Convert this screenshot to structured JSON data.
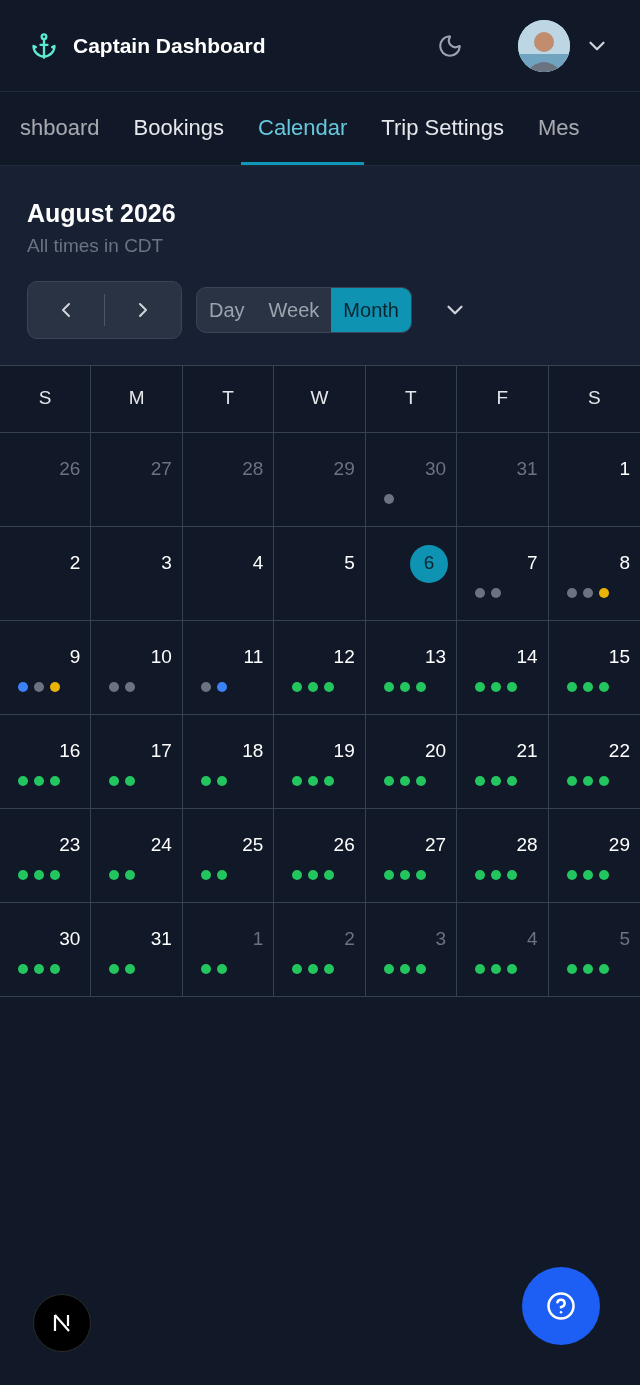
{
  "app_title": "Captain Dashboard",
  "tabs": [
    {
      "label": "shboard",
      "selected": false
    },
    {
      "label": "Bookings",
      "selected": false
    },
    {
      "label": "Calendar",
      "selected": true
    },
    {
      "label": "Trip Settings",
      "selected": false
    },
    {
      "label": "Mes",
      "selected": false
    }
  ],
  "calendar": {
    "month_title": "August 2026",
    "timezone_note": "All times in CDT",
    "views": [
      {
        "label": "Day",
        "selected": false
      },
      {
        "label": "Week",
        "selected": false
      },
      {
        "label": "Month",
        "selected": true
      }
    ],
    "weekdays": [
      "S",
      "M",
      "T",
      "W",
      "T",
      "F",
      "S"
    ],
    "weeks": [
      {
        "days": [
          {
            "date": "26",
            "muted": true,
            "today": false
          },
          {
            "date": "27",
            "muted": true,
            "today": false
          },
          {
            "date": "28",
            "muted": true,
            "today": false
          },
          {
            "date": "29",
            "muted": true,
            "today": false
          },
          {
            "date": "30",
            "muted": true,
            "today": false,
            "dots": [
              {
                "color": "#6b7280"
              }
            ]
          },
          {
            "date": "31",
            "muted": true,
            "today": false
          },
          {
            "date": "1",
            "muted": false,
            "today": false
          }
        ]
      },
      {
        "days": [
          {
            "date": "2",
            "muted": false,
            "today": false
          },
          {
            "date": "3",
            "muted": false,
            "today": false
          },
          {
            "date": "4",
            "muted": false,
            "today": false
          },
          {
            "date": "5",
            "muted": false,
            "today": false
          },
          {
            "date": "6",
            "today": true
          },
          {
            "date": "7",
            "muted": false,
            "today": false,
            "dots": [
              {
                "color": "#6b7280"
              },
              {
                "color": "#6b7280"
              }
            ]
          },
          {
            "date": "8",
            "muted": false,
            "today": false,
            "dots": [
              {
                "color": "#6b7280"
              },
              {
                "color": "#6b7280"
              },
              {
                "color": "#eab308"
              }
            ]
          }
        ]
      },
      {
        "days": [
          {
            "date": "9",
            "muted": false,
            "today": false,
            "dots": [
              {
                "color": "#3b82f6"
              },
              {
                "color": "#6b7280"
              },
              {
                "color": "#eab308"
              }
            ]
          },
          {
            "date": "10",
            "muted": false,
            "today": false,
            "dots": [
              {
                "color": "#6b7280"
              },
              {
                "color": "#6b7280"
              }
            ]
          },
          {
            "date": "11",
            "muted": false,
            "today": false,
            "dots": [
              {
                "color": "#6b7280"
              },
              {
                "color": "#3b82f6"
              }
            ]
          },
          {
            "date": "12",
            "muted": false,
            "today": false,
            "dots": [
              {
                "color": "#22c55e"
              },
              {
                "color": "#22c55e"
              },
              {
                "color": "#22c55e"
              }
            ]
          },
          {
            "date": "13",
            "muted": false,
            "today": false,
            "dots": [
              {
                "color": "#22c55e"
              },
              {
                "color": "#22c55e"
              },
              {
                "color": "#22c55e"
              }
            ]
          },
          {
            "date": "14",
            "muted": false,
            "today": false,
            "dots": [
              {
                "color": "#22c55e"
              },
              {
                "color": "#22c55e"
              },
              {
                "color": "#22c55e"
              }
            ]
          },
          {
            "date": "15",
            "muted": false,
            "today": false,
            "dots": [
              {
                "color": "#22c55e"
              },
              {
                "color": "#22c55e"
              },
              {
                "color": "#22c55e"
              }
            ]
          }
        ]
      },
      {
        "days": [
          {
            "date": "16",
            "muted": false,
            "today": false,
            "dots": [
              {
                "color": "#22c55e"
              },
              {
                "color": "#22c55e"
              },
              {
                "color": "#22c55e"
              }
            ]
          },
          {
            "date": "17",
            "muted": false,
            "today": false,
            "dots": [
              {
                "color": "#22c55e"
              },
              {
                "color": "#22c55e"
              }
            ]
          },
          {
            "date": "18",
            "muted": false,
            "today": false,
            "dots": [
              {
                "color": "#22c55e"
              },
              {
                "color": "#22c55e"
              }
            ]
          },
          {
            "date": "19",
            "muted": false,
            "today": false,
            "dots": [
              {
                "color": "#22c55e"
              },
              {
                "color": "#22c55e"
              },
              {
                "color": "#22c55e"
              }
            ]
          },
          {
            "date": "20",
            "muted": false,
            "today": false,
            "dots": [
              {
                "color": "#22c55e"
              },
              {
                "color": "#22c55e"
              },
              {
                "color": "#22c55e"
              }
            ]
          },
          {
            "date": "21",
            "muted": false,
            "today": false,
            "dots": [
              {
                "color": "#22c55e"
              },
              {
                "color": "#22c55e"
              },
              {
                "color": "#22c55e"
              }
            ]
          },
          {
            "date": "22",
            "muted": false,
            "today": false,
            "dots": [
              {
                "color": "#22c55e"
              },
              {
                "color": "#22c55e"
              },
              {
                "color": "#22c55e"
              }
            ]
          }
        ]
      },
      {
        "days": [
          {
            "date": "23",
            "muted": false,
            "today": false,
            "dots": [
              {
                "color": "#22c55e"
              },
              {
                "color": "#22c55e"
              },
              {
                "color": "#22c55e"
              }
            ]
          },
          {
            "date": "24",
            "muted": false,
            "today": false,
            "dots": [
              {
                "color": "#22c55e"
              },
              {
                "color": "#22c55e"
              }
            ]
          },
          {
            "date": "25",
            "muted": false,
            "today": false,
            "dots": [
              {
                "color": "#22c55e"
              },
              {
                "color": "#22c55e"
              }
            ]
          },
          {
            "date": "26",
            "muted": false,
            "today": false,
            "dots": [
              {
                "color": "#22c55e"
              },
              {
                "color": "#22c55e"
              },
              {
                "color": "#22c55e"
              }
            ]
          },
          {
            "date": "27",
            "muted": false,
            "today": false,
            "dots": [
              {
                "color": "#22c55e"
              },
              {
                "color": "#22c55e"
              },
              {
                "color": "#22c55e"
              }
            ]
          },
          {
            "date": "28",
            "muted": false,
            "today": false,
            "dots": [
              {
                "color": "#22c55e"
              },
              {
                "color": "#22c55e"
              },
              {
                "color": "#22c55e"
              }
            ]
          },
          {
            "date": "29",
            "muted": false,
            "today": false,
            "dots": [
              {
                "color": "#22c55e"
              },
              {
                "color": "#22c55e"
              },
              {
                "color": "#22c55e"
              }
            ]
          }
        ]
      },
      {
        "days": [
          {
            "date": "30",
            "muted": false,
            "today": false,
            "dots": [
              {
                "color": "#22c55e"
              },
              {
                "color": "#22c55e"
              },
              {
                "color": "#22c55e"
              }
            ]
          },
          {
            "date": "31",
            "muted": false,
            "today": false,
            "dots": [
              {
                "color": "#22c55e"
              },
              {
                "color": "#22c55e"
              }
            ]
          },
          {
            "date": "1",
            "muted": true,
            "today": false,
            "dots": [
              {
                "color": "#22c55e"
              },
              {
                "color": "#22c55e"
              }
            ]
          },
          {
            "date": "2",
            "muted": true,
            "today": false,
            "dots": [
              {
                "color": "#22c55e"
              },
              {
                "color": "#22c55e"
              },
              {
                "color": "#22c55e"
              }
            ]
          },
          {
            "date": "3",
            "muted": true,
            "today": false,
            "dots": [
              {
                "color": "#22c55e"
              },
              {
                "color": "#22c55e"
              },
              {
                "color": "#22c55e"
              }
            ]
          },
          {
            "date": "4",
            "muted": true,
            "today": false,
            "dots": [
              {
                "color": "#22c55e"
              },
              {
                "color": "#22c55e"
              },
              {
                "color": "#22c55e"
              }
            ]
          },
          {
            "date": "5",
            "muted": true,
            "today": false,
            "dots": [
              {
                "color": "#22c55e"
              },
              {
                "color": "#22c55e"
              },
              {
                "color": "#22c55e"
              }
            ]
          }
        ]
      }
    ]
  }
}
